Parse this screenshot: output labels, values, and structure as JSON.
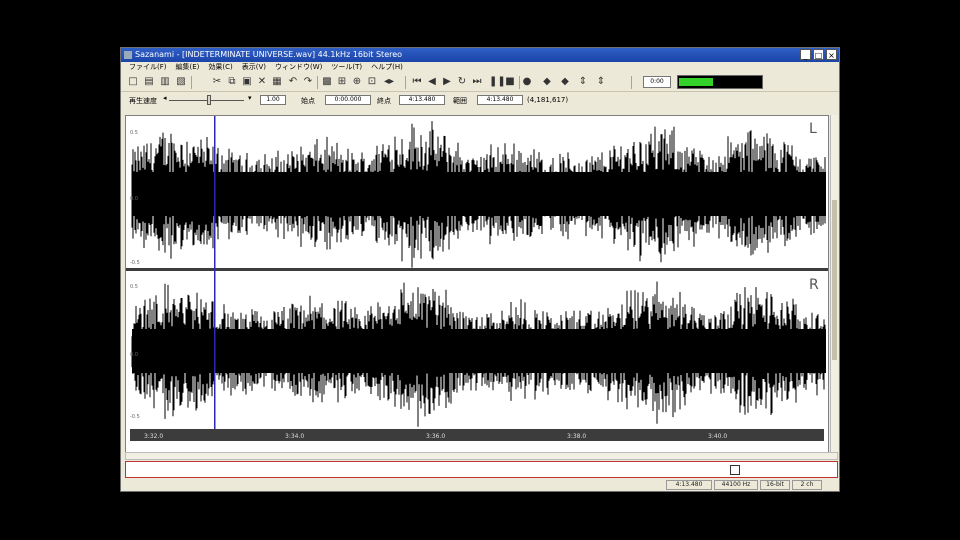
{
  "window": {
    "title": "Sazanami - [INDETERMINATE UNIVERSE.wav] 44.1kHz 16bit Stereo"
  },
  "window_buttons": [
    "_",
    "□",
    "×"
  ],
  "menu": [
    "ファイル(F)",
    "編集(E)",
    "効果(C)",
    "表示(V)",
    "ウィンドウ(W)",
    "ツール(T)",
    "ヘルプ(H)"
  ],
  "toolbar": {
    "buttons": [
      {
        "name": "new-file-icon",
        "glyph": "□"
      },
      {
        "name": "open-file-icon",
        "glyph": "▤"
      },
      {
        "name": "save-icon",
        "glyph": "▥"
      },
      {
        "name": "save-as-icon",
        "glyph": "▧"
      },
      {
        "name": "cut-icon",
        "glyph": "✂"
      },
      {
        "name": "copy-icon",
        "glyph": "⧉"
      },
      {
        "name": "paste-icon",
        "glyph": "▣"
      },
      {
        "name": "delete-icon",
        "glyph": "✕"
      },
      {
        "name": "mix-paste-icon",
        "glyph": "▦"
      },
      {
        "name": "undo-icon",
        "glyph": "↶"
      },
      {
        "name": "redo-icon",
        "glyph": "↷"
      },
      {
        "name": "select-all-icon",
        "glyph": "▩"
      },
      {
        "name": "zoom-fit-icon",
        "glyph": "⊞"
      },
      {
        "name": "zoom-in-icon",
        "glyph": "⊕"
      },
      {
        "name": "zoom-select-icon",
        "glyph": "⊡"
      },
      {
        "name": "zoom-out-icon",
        "glyph": "◂▸"
      },
      {
        "name": "rewind-start-icon",
        "glyph": "⏮"
      },
      {
        "name": "rewind-icon",
        "glyph": "◀"
      },
      {
        "name": "play-icon",
        "glyph": "▶"
      },
      {
        "name": "play-loop-icon",
        "glyph": "↻"
      },
      {
        "name": "fast-forward-icon",
        "glyph": "⏭"
      },
      {
        "name": "pause-icon",
        "glyph": "❚❚"
      },
      {
        "name": "stop-icon",
        "glyph": "■"
      },
      {
        "name": "record-icon",
        "glyph": "●"
      },
      {
        "name": "jump-icon",
        "glyph": "◆"
      },
      {
        "name": "marker-icon",
        "glyph": "◆"
      },
      {
        "name": "scroll-up-down-icon",
        "glyph": "⇕"
      },
      {
        "name": "vertical-zoom-icon",
        "glyph": "⇕"
      }
    ],
    "position_value": "0:00"
  },
  "speed": {
    "label": "再生速度",
    "value": "1.00",
    "fields": [
      {
        "label": "始点",
        "value": "0:00.000"
      },
      {
        "label": "終点",
        "value": "4:13.480"
      },
      {
        "label": "範囲",
        "value": "4:13.480"
      }
    ],
    "samples": "(4,181,617)"
  },
  "waveform": {
    "channels": [
      "L",
      "R"
    ],
    "scale_labels": [
      "0.5",
      "0.0",
      "-0.5"
    ],
    "timeline": [
      "3:32.0",
      "3:34.0",
      "3:36.0",
      "3:38.0",
      "3:40.0"
    ],
    "colors": {
      "waveform": "#000000",
      "cursor": "#2a2ab0",
      "timeline_bg": "#3c3c3c"
    }
  },
  "status": [
    "4:13.480",
    "44100 Hz",
    "16-bit",
    "2 ch"
  ],
  "level_meter": {
    "level": 0.4,
    "color": "#34d12a"
  }
}
